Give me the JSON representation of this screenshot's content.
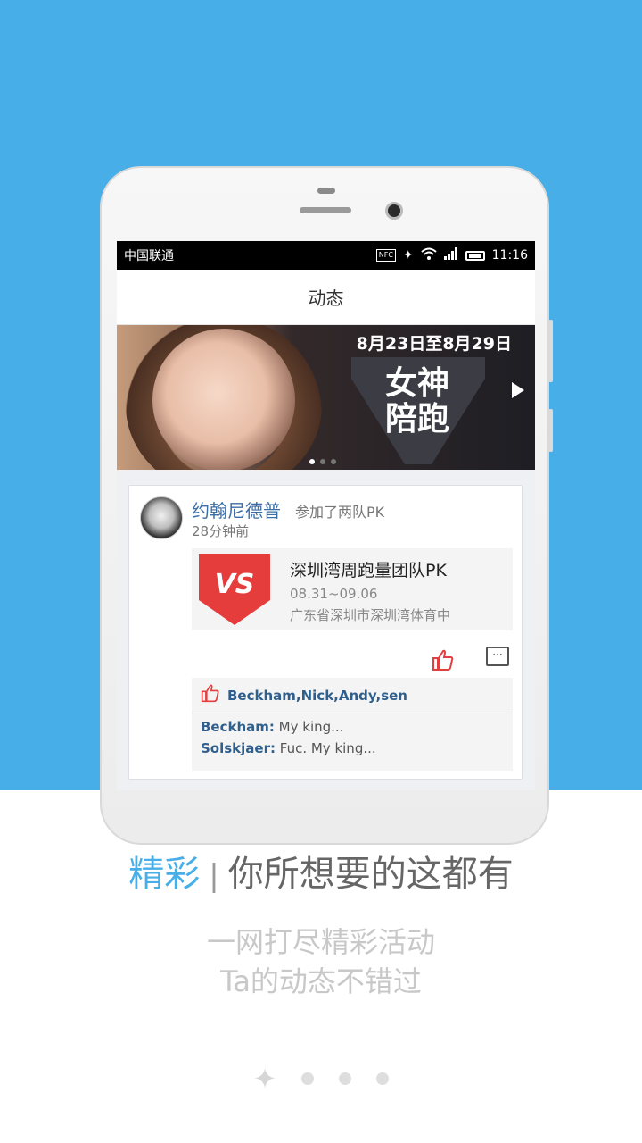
{
  "status_bar": {
    "carrier": "中国联通",
    "nfc": "NFC",
    "time": "11:16"
  },
  "app_bar": {
    "title": "动态"
  },
  "banner": {
    "date_range": "8月23日至8月29日",
    "title": "女神陪跑",
    "page_count": 3,
    "active_page": 1
  },
  "feed_card": {
    "user_name": "约翰尼德普",
    "action": "参加了两队PK",
    "time_ago": "28分钟前",
    "event": {
      "badge": "VS",
      "title": "深圳湾周跑量团队PK",
      "date": "08.31~09.06",
      "location": "广东省深圳市深圳湾体育中"
    },
    "likes": {
      "names": "Beckham,Nick,Andy,sen"
    },
    "comments": [
      {
        "author": "Beckham:",
        "text": " My  king..."
      },
      {
        "author": "Solskjaer:",
        "text": " Fuc.  My  king..."
      }
    ]
  },
  "caption": {
    "accent": "精彩",
    "divider": "|",
    "headline": "你所想要的这都有",
    "sub1": "一网打尽精彩活动",
    "sub2": "Ta的动态不错过"
  },
  "pager": {
    "total": 4,
    "active": 1
  },
  "colors": {
    "accent": "#47aee8",
    "like_red": "#e24040",
    "vs_red": "#e53c3c"
  }
}
